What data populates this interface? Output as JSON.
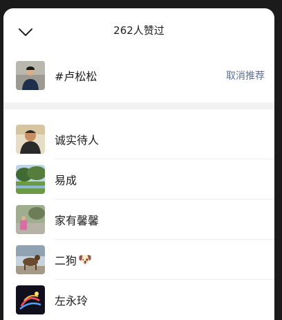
{
  "header": {
    "title": "262人赞过"
  },
  "topic": {
    "name": "#卢松松",
    "action_label": "取消推荐"
  },
  "users": [
    {
      "name": "诚实待人",
      "emoji": ""
    },
    {
      "name": "易成",
      "emoji": ""
    },
    {
      "name": "家有馨馨",
      "emoji": ""
    },
    {
      "name": "二狗",
      "emoji": "🐶"
    },
    {
      "name": "左永玲",
      "emoji": ""
    }
  ],
  "colors": {
    "link": "#5a6f95",
    "band": "#f2f2f2"
  }
}
